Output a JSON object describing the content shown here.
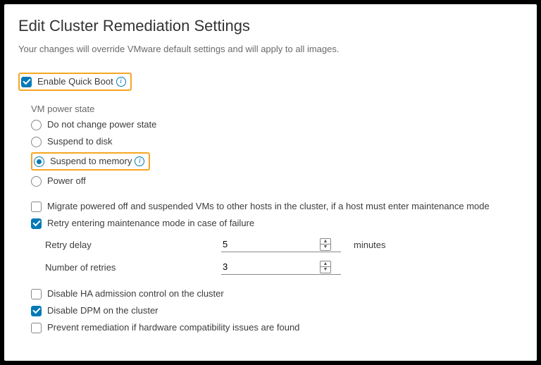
{
  "title": "Edit Cluster Remediation Settings",
  "subtitle": "Your changes will override VMware default settings and will apply to all images.",
  "quickBoot": {
    "label": "Enable Quick Boot",
    "checked": true
  },
  "vmPowerState": {
    "heading": "VM power state",
    "options": {
      "noChange": "Do not change power state",
      "suspendDisk": "Suspend to disk",
      "suspendMem": "Suspend to memory",
      "powerOff": "Power off"
    },
    "selected": "suspendMem"
  },
  "migrate": {
    "label": "Migrate powered off and suspended VMs to other hosts in the cluster, if a host must enter maintenance mode",
    "checked": false
  },
  "retry": {
    "label": "Retry entering maintenance mode in case of failure",
    "checked": true,
    "delay": {
      "label": "Retry delay",
      "value": "5",
      "unit": "minutes"
    },
    "count": {
      "label": "Number of retries",
      "value": "3"
    }
  },
  "disableHA": {
    "label": "Disable HA admission control on the cluster",
    "checked": false
  },
  "disableDPM": {
    "label": "Disable DPM on the cluster",
    "checked": true
  },
  "preventCompat": {
    "label": "Prevent remediation if hardware compatibility issues are found",
    "checked": false
  }
}
